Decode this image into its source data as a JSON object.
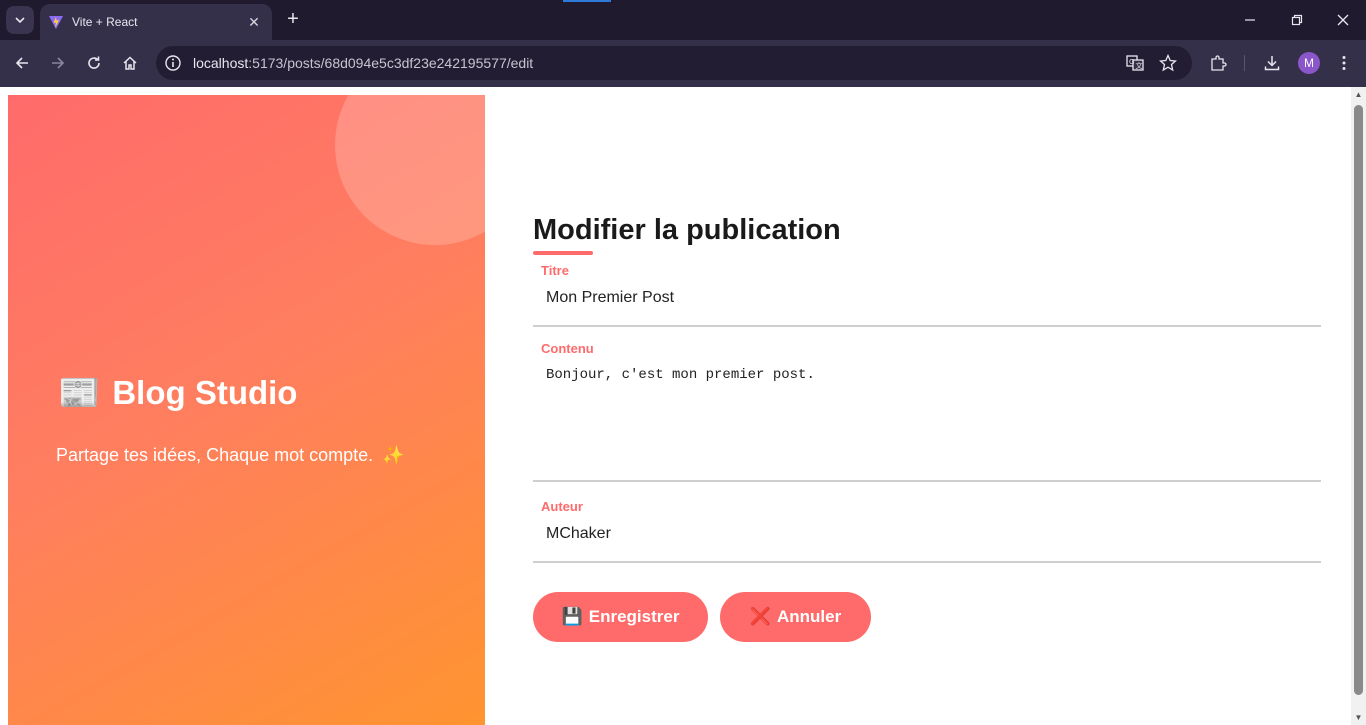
{
  "browser": {
    "tab_title": "Vite + React",
    "url_host": "localhost",
    "url_path": ":5173/posts/68d094e5c3df23e242195577/edit",
    "profile_initial": "M"
  },
  "hero": {
    "brand_icon": "📰",
    "brand_name": "Blog Studio",
    "tagline": "Partage tes idées, Chaque mot compte.",
    "tagline_icon": "✨"
  },
  "form": {
    "heading": "Modifier la publication",
    "fields": {
      "title": {
        "label": "Titre",
        "value": "Mon Premier Post"
      },
      "content": {
        "label": "Contenu",
        "value": "Bonjour, c'est mon premier post."
      },
      "author": {
        "label": "Auteur",
        "value": "MChaker"
      }
    },
    "buttons": {
      "save": {
        "icon": "💾",
        "label": "Enregistrer"
      },
      "cancel": {
        "icon": "❌",
        "label": "Annuler"
      }
    }
  },
  "colors": {
    "accent": "#ff6b6b",
    "gradient_start": "#ff6b6b",
    "gradient_end": "#ff9430"
  }
}
